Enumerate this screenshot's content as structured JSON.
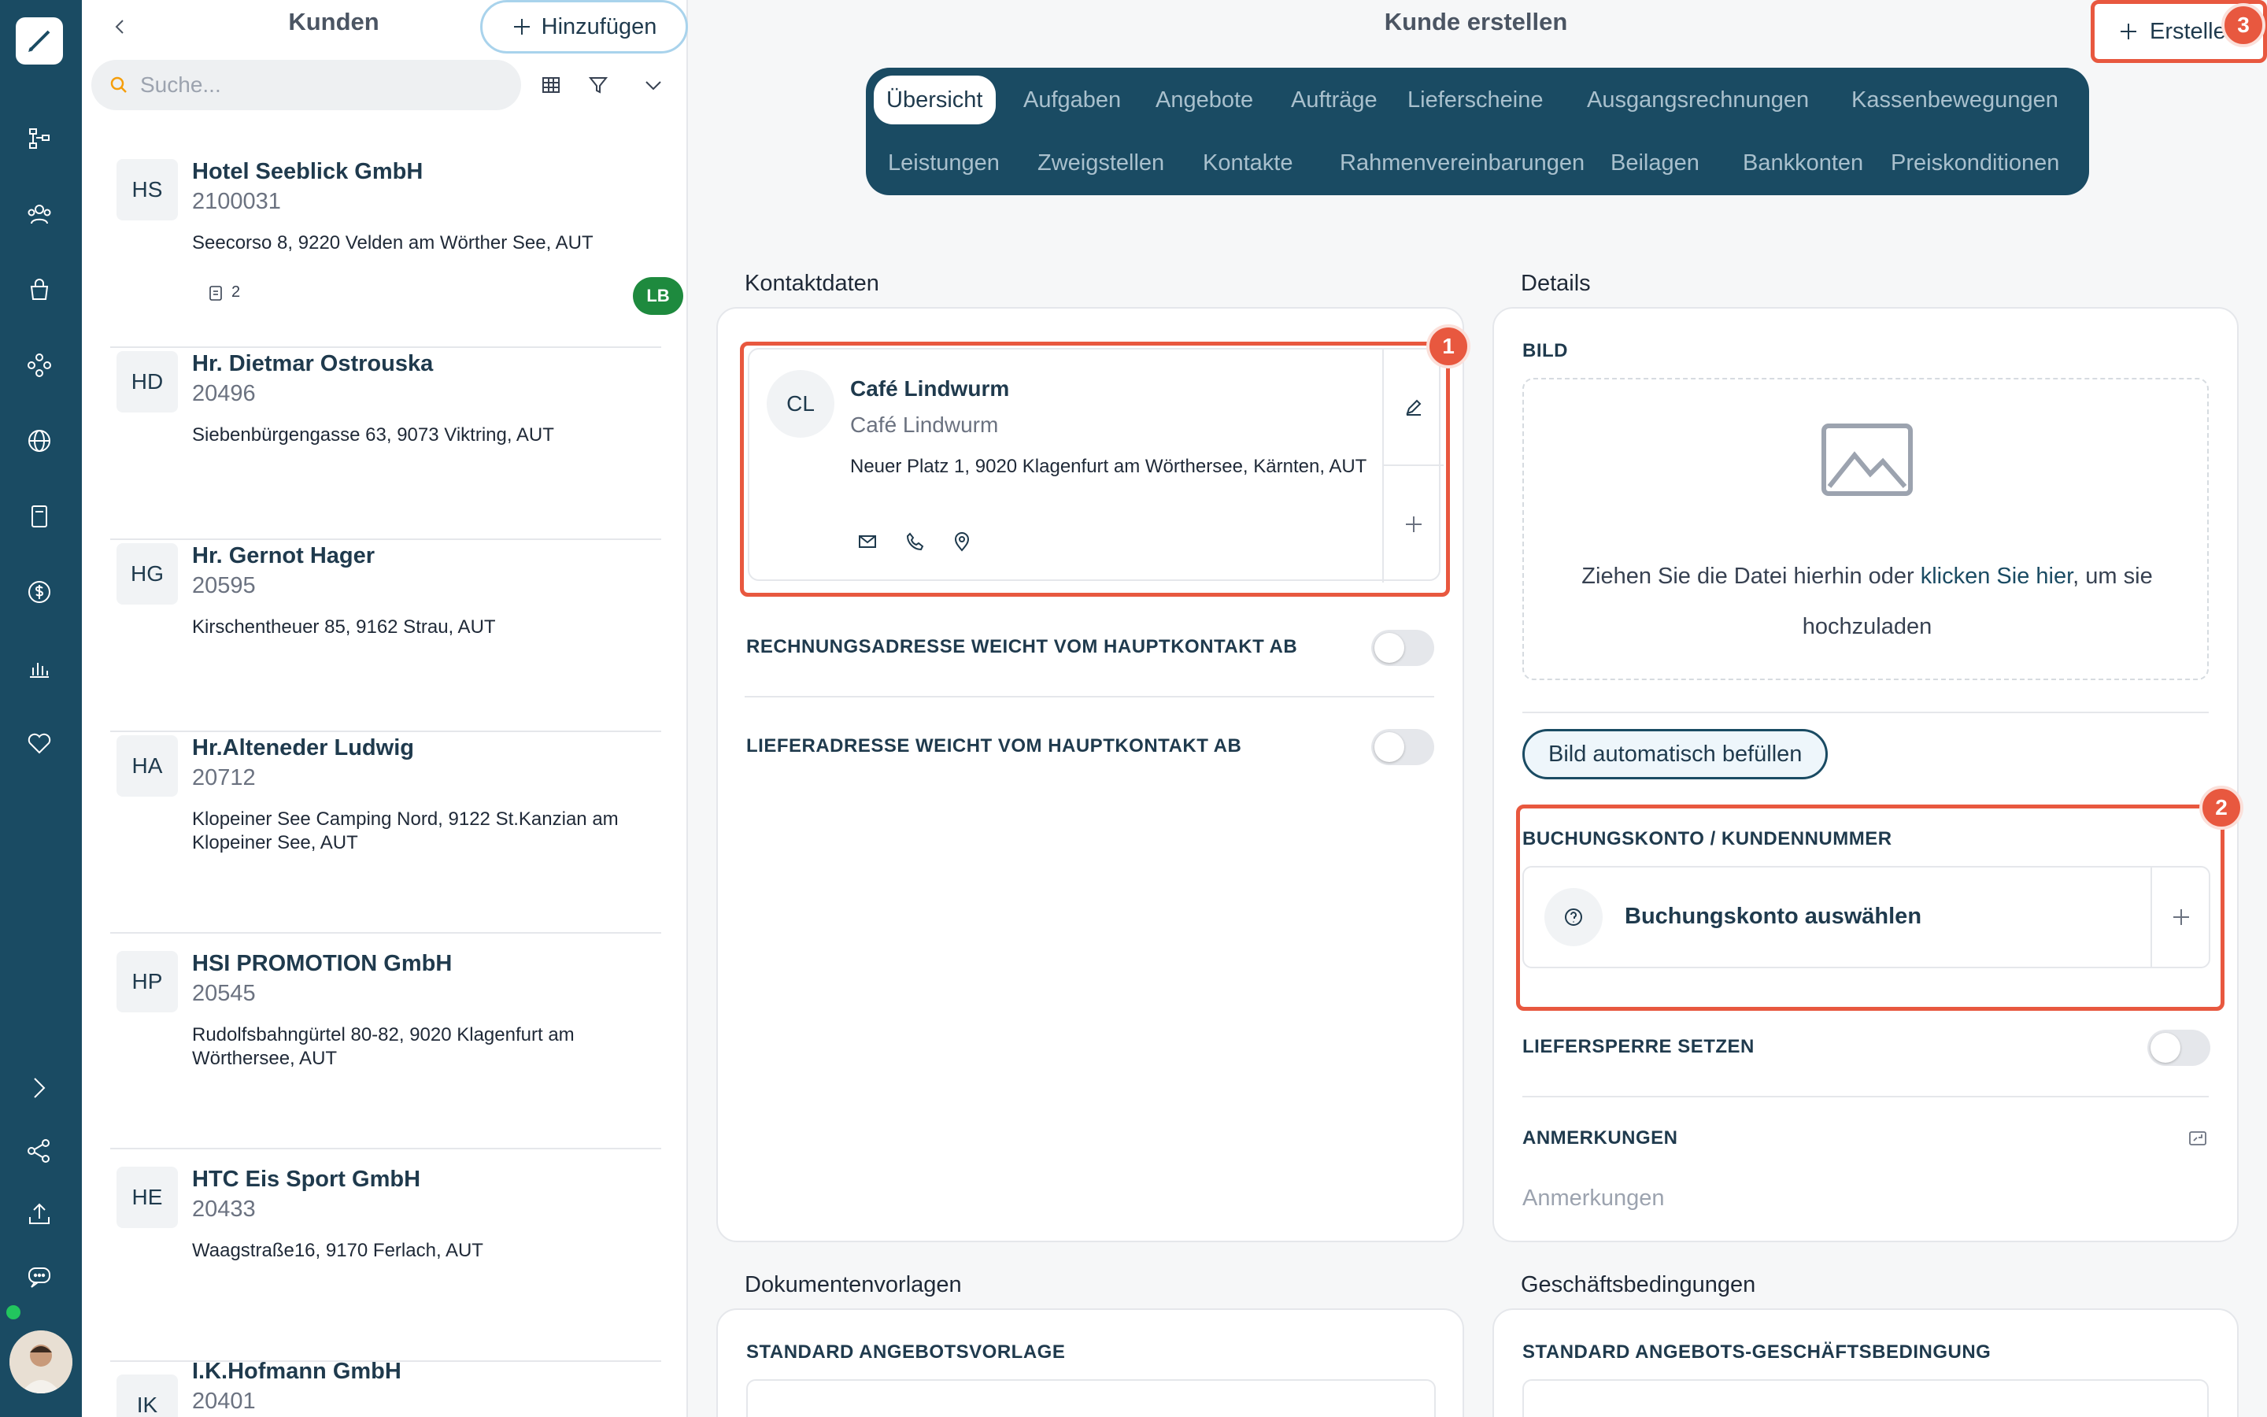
{
  "list": {
    "title": "Kunden",
    "add_label": "Hinzufügen",
    "search_placeholder": "Suche...",
    "customers": [
      {
        "initials": "HS",
        "name": "Hotel Seeblick GmbH",
        "number": "2100031",
        "address": "Seecorso 8, 9220 Velden am Wörther See, AUT",
        "docs": "2",
        "badge": "LB"
      },
      {
        "initials": "HD",
        "name": "Hr. Dietmar Ostrouska",
        "number": "20496",
        "address": "Siebenbürgengasse 63, 9073 Viktring, AUT"
      },
      {
        "initials": "HG",
        "name": "Hr. Gernot Hager",
        "number": "20595",
        "address": "Kirschentheuer 85, 9162 Strau, AUT"
      },
      {
        "initials": "HA",
        "name": "Hr.Alteneder Ludwig",
        "number": "20712",
        "address": "Klopeiner See Camping Nord, 9122 St.Kanzian am Klopeiner See, AUT"
      },
      {
        "initials": "HP",
        "name": "HSI PROMOTION GmbH",
        "number": "20545",
        "address": "Rudolfsbahngürtel 80-82, 9020 Klagenfurt am Wörthersee, AUT"
      },
      {
        "initials": "HE",
        "name": "HTC Eis Sport GmbH",
        "number": "20433",
        "address": "Waagstraße16, 9170 Ferlach, AUT"
      },
      {
        "initials": "IK",
        "name": "I.K.Hofmann GmbH",
        "number": "20401",
        "address": ""
      }
    ]
  },
  "main": {
    "title": "Kunde erstellen",
    "create_label": "Erstelle",
    "tabs_row1": [
      "Übersicht",
      "Aufgaben",
      "Angebote",
      "Aufträge",
      "Lieferscheine",
      "Ausgangsrechnungen",
      "Kassenbewegungen"
    ],
    "tabs_row2": [
      "Leistungen",
      "Zweigstellen",
      "Kontakte",
      "Rahmenvereinbarungen",
      "Beilagen",
      "Bankkonten",
      "Preiskonditionen"
    ],
    "contact": {
      "section": "Kontaktdaten",
      "initials": "CL",
      "name": "Café Lindwurm",
      "subname": "Café Lindwurm",
      "address": "Neuer Platz 1, 9020 Klagenfurt am Wörthersee, Kärnten, AUT",
      "billing_toggle": "RECHNUNGSADRESSE WEICHT VOM HAUPTKONTAKT AB",
      "delivery_toggle": "LIEFERADRESSE WEICHT VOM HAUPTKONTAKT AB"
    },
    "details": {
      "section": "Details",
      "image_label": "BILD",
      "drop_text_1": "Ziehen Sie die Datei hierhin oder ",
      "drop_link": "klicken Sie hier",
      "drop_text_2": ", um sie",
      "drop_text_3": "hochzuladen",
      "autofill_label": "Bild automatisch befüllen",
      "account_label": "BUCHUNGSKONTO / KUNDENNUMMER",
      "account_placeholder": "Buchungskonto auswählen",
      "delivery_block_label": "LIEFERSPERRE SETZEN",
      "notes_label": "ANMERKUNGEN",
      "notes_placeholder": "Anmerkungen"
    },
    "documents": {
      "section": "Dokumentenvorlagen",
      "quote_template": "STANDARD ANGEBOTSVORLAGE"
    },
    "terms": {
      "section": "Geschäftsbedingungen",
      "quote_terms": "STANDARD ANGEBOTS-GESCHÄFTSBEDINGUNG"
    },
    "steps": [
      "1",
      "2",
      "3"
    ]
  },
  "colors": {
    "rail": "#1a4b63",
    "accent": "#e8583f",
    "badge": "#1e8a3e"
  },
  "icons": [
    "brush-icon",
    "hierarchy-icon",
    "users-icon",
    "bag-icon",
    "modules-icon",
    "globe-icon",
    "book-icon",
    "dollar-icon",
    "chart-icon",
    "heart-icon",
    "chevron-right-icon",
    "share-icon",
    "upload-icon",
    "chat-icon"
  ]
}
